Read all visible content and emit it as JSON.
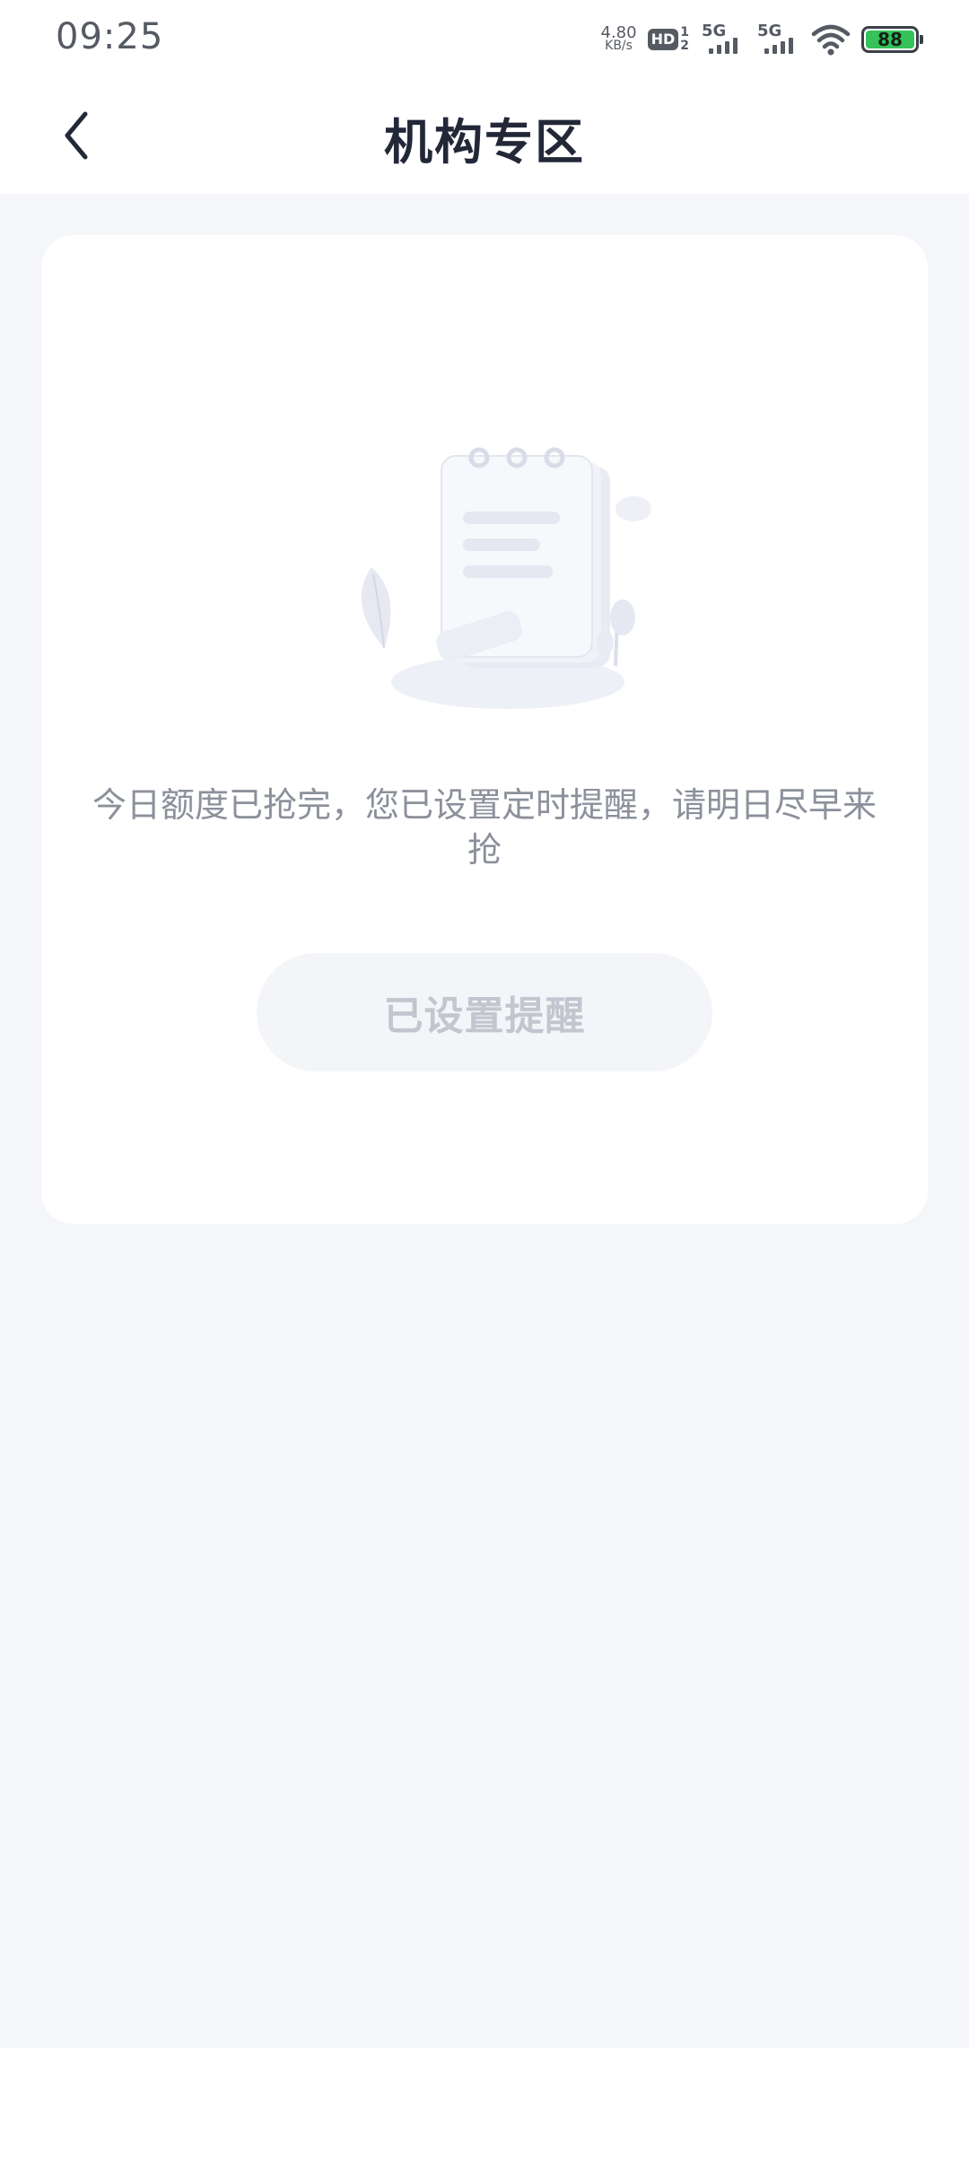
{
  "status_bar": {
    "time": "09:25",
    "net_speed_value": "4.80",
    "net_speed_unit": "KB/s",
    "hd_label": "HD",
    "hd_sim_top": "1",
    "hd_sim_bottom": "2",
    "sim1_label": "5G",
    "sim2_label": "5G",
    "battery_level": "88",
    "battery_color": "#35c259"
  },
  "nav": {
    "back_icon": "chevron-left-icon",
    "title": "机构专区"
  },
  "card": {
    "illustration": "empty-notepad-illustration",
    "message": "今日额度已抢完，您已设置定时提醒，请明日尽早来抢",
    "button_label": "已设置提醒"
  }
}
